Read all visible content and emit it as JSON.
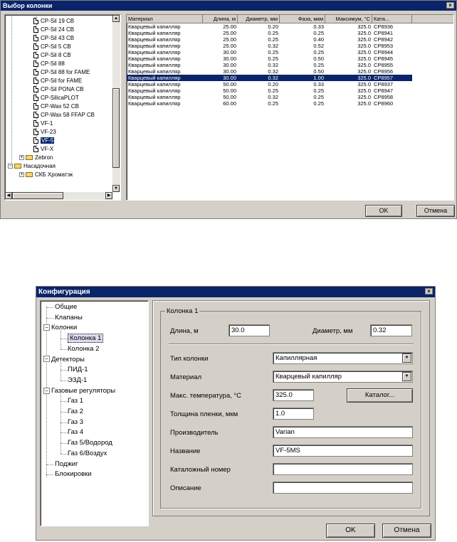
{
  "dialog1": {
    "title": "Выбор колонки",
    "close_glyph": "×",
    "tree": [
      {
        "label": "CP-Sil 19 CB",
        "type": "doc"
      },
      {
        "label": "CP-Sil 24 CB",
        "type": "doc"
      },
      {
        "label": "CP-Sil 43 CB",
        "type": "doc"
      },
      {
        "label": "CP-Sil 5 CB",
        "type": "doc"
      },
      {
        "label": "CP-Sil 8 CB",
        "type": "doc"
      },
      {
        "label": "CP-Sil 88",
        "type": "doc"
      },
      {
        "label": "CP-Sil 88 for FAME",
        "type": "doc"
      },
      {
        "label": "CP-Sil for FAME",
        "type": "doc"
      },
      {
        "label": "CP-Sil PONA CB",
        "type": "doc"
      },
      {
        "label": "CP-SilicaPLOT",
        "type": "doc"
      },
      {
        "label": "CP-Wax 52 CB",
        "type": "doc"
      },
      {
        "label": "CP-Wax 58 FFAP CB",
        "type": "doc"
      },
      {
        "label": "VF-1",
        "type": "doc"
      },
      {
        "label": "VF-23",
        "type": "doc"
      },
      {
        "label": "VF-5",
        "type": "doc",
        "selected": true
      },
      {
        "label": "VF-X",
        "type": "doc"
      },
      {
        "label": "Zebron",
        "type": "folder",
        "expander": "+"
      },
      {
        "label": "Насадочная",
        "type": "folder",
        "expander": "−"
      },
      {
        "label": "СКБ Хроматэк",
        "type": "folder",
        "expander": "+"
      }
    ],
    "columns": [
      "Материал",
      "Длина, м",
      "Диаметр, мм",
      "Фаза, мкм",
      "Максимум, °C",
      "Ката..."
    ],
    "rows": [
      [
        "Кварцевый капилляр",
        "25.00",
        "0.20",
        "0.33",
        "325.0",
        "CP8936"
      ],
      [
        "Кварцевый капилляр",
        "25.00",
        "0.25",
        "0.25",
        "325.0",
        "CP8941"
      ],
      [
        "Кварцевый капилляр",
        "25.00",
        "0.25",
        "0.40",
        "325.0",
        "CP8942"
      ],
      [
        "Кварцевый капилляр",
        "25.00",
        "0.32",
        "0.52",
        "325.0",
        "CP8953"
      ],
      [
        "Кварцевый капилляр",
        "30.00",
        "0.25",
        "0.25",
        "325.0",
        "CP8944"
      ],
      [
        "Кварцевый капилляр",
        "30.00",
        "0.25",
        "0.50",
        "325.0",
        "CP8945"
      ],
      [
        "Кварцевый капилляр",
        "30.00",
        "0.32",
        "0.25",
        "325.0",
        "CP8955"
      ],
      [
        "Кварцевый капилляр",
        "30.00",
        "0.32",
        "0.50",
        "325.0",
        "CP8956"
      ],
      [
        "Кварцевый капилляр",
        "30.00",
        "0.32",
        "1.00",
        "325.0",
        "CP8957"
      ],
      [
        "Кварцевый капилляр",
        "50.00",
        "0.20",
        "0.33",
        "325.0",
        "CP8937"
      ],
      [
        "Кварцевый капилляр",
        "50.00",
        "0.25",
        "0.25",
        "325.0",
        "CP8947"
      ],
      [
        "Кварцевый капилляр",
        "50.00",
        "0.32",
        "0.25",
        "325.0",
        "CP8958"
      ],
      [
        "Кварцевый капилляр",
        "60.00",
        "0.25",
        "0.25",
        "325.0",
        "CP8960"
      ]
    ],
    "selected_row": 8,
    "ok_label": "OK",
    "cancel_label": "Отмена"
  },
  "dialog2": {
    "title": "Конфигурация",
    "close_glyph": "×",
    "tree": [
      {
        "label": "Общие",
        "level": 0
      },
      {
        "label": "Клапаны",
        "level": 0
      },
      {
        "label": "Колонки",
        "level": 0,
        "expander": "−"
      },
      {
        "label": "Колонка 1",
        "level": 1,
        "selected": true
      },
      {
        "label": "Колонка 2",
        "level": 1
      },
      {
        "label": "Детекторы",
        "level": 0,
        "expander": "−"
      },
      {
        "label": "ПИД-1",
        "level": 1
      },
      {
        "label": "ЭЗД-1",
        "level": 1
      },
      {
        "label": "Газовые регуляторы",
        "level": 0,
        "expander": "−"
      },
      {
        "label": "Газ 1",
        "level": 1
      },
      {
        "label": "Газ 2",
        "level": 1
      },
      {
        "label": "Газ 3",
        "level": 1
      },
      {
        "label": "Газ 4",
        "level": 1
      },
      {
        "label": "Газ 5/Водород",
        "level": 1
      },
      {
        "label": "Газ 6/Воздух",
        "level": 1
      },
      {
        "label": "Поджиг",
        "level": 0
      },
      {
        "label": "Блокировки",
        "level": 0
      }
    ],
    "group_title": "Колонка 1",
    "length_label": "Длина, м",
    "length_value": "30.0",
    "diameter_label": "Диаметр, мм",
    "diameter_value": "0.32",
    "type_label": "Тип колонки",
    "type_value": "Капиллярная",
    "material_label": "Материал",
    "material_value": "Кварцевый капилляр",
    "maxtemp_label": "Макс. температура, °C",
    "maxtemp_value": "325.0",
    "catalog_button": "Каталог...",
    "film_label": "Толщина пленки, мкм",
    "film_value": "1.0",
    "manufacturer_label": "Производитель",
    "manufacturer_value": "Varian",
    "name_label": "Название",
    "name_value": "VF-5MS",
    "catalog_no_label": "Каталожный номер",
    "catalog_no_value": "",
    "description_label": "Описание",
    "description_value": "",
    "ok_label": "OK",
    "cancel_label": "Отмена"
  }
}
